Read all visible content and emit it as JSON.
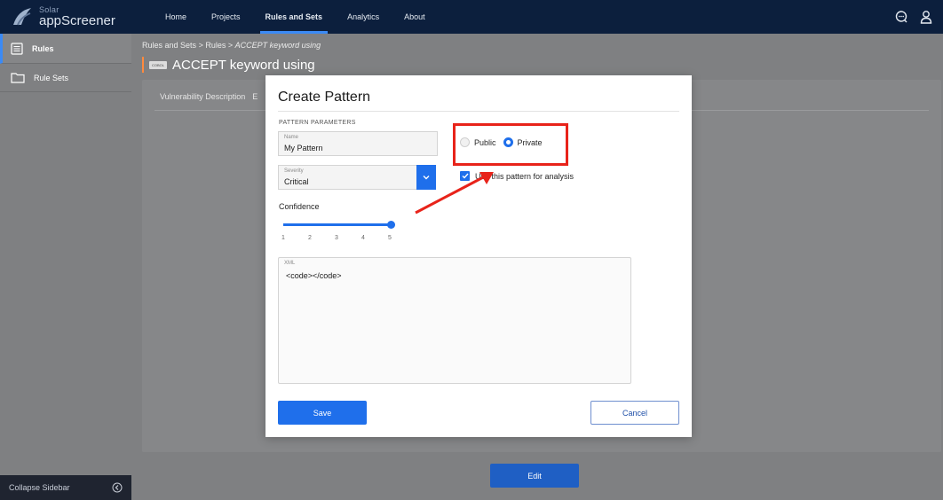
{
  "header": {
    "logo_small": "Solar",
    "logo_big": "appScreener",
    "nav": [
      "Home",
      "Projects",
      "Rules and Sets",
      "Analytics",
      "About"
    ],
    "active_nav": "Rules and Sets"
  },
  "sidebar": {
    "items": [
      {
        "label": "Rules",
        "icon": "list-icon"
      },
      {
        "label": "Rule Sets",
        "icon": "folder-icon"
      }
    ],
    "collapse_label": "Collapse Sidebar"
  },
  "breadcrumb": {
    "part1": "Rules and Sets",
    "sep": ">",
    "part2": "Rules",
    "part3": "ACCEPT keyword using"
  },
  "page": {
    "badge": "COBOL",
    "title": "ACCEPT keyword using",
    "tab1": "Vulnerability Description",
    "tab2": "E",
    "edit_label": "Edit"
  },
  "modal": {
    "title": "Create Pattern",
    "section": "PATTERN PARAMETERS",
    "name_label": "Name",
    "name_value": "My Pattern",
    "severity_label": "Severity",
    "severity_value": "Critical",
    "public_label": "Public",
    "private_label": "Private",
    "visibility_selected": "Private",
    "check_label": "Use this pattern for analysis",
    "check_checked": true,
    "confidence_label": "Confidence",
    "confidence_value": 5,
    "confidence_ticks": [
      "1",
      "2",
      "3",
      "4",
      "5"
    ],
    "xml_label": "XML",
    "xml_value": "<code></code>",
    "save_label": "Save",
    "cancel_label": "Cancel"
  },
  "colors": {
    "accent": "#1f6feb",
    "header": "#0c1f3d",
    "highlight": "#e8231a"
  }
}
